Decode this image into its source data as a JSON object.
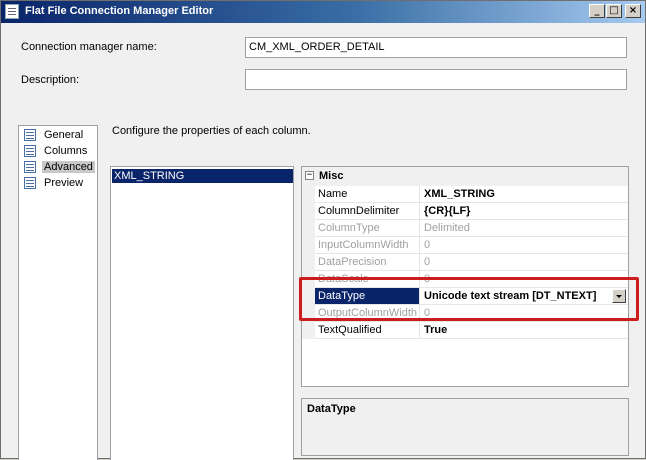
{
  "window": {
    "title": "Flat File Connection Manager Editor",
    "icon": "flat-file-icon"
  },
  "titlebar_buttons": {
    "minimize": "_",
    "maximize": "□",
    "close": "×"
  },
  "form": {
    "connection_name_label": "Connection manager name:",
    "connection_name_value": "CM_XML_ORDER_DETAIL",
    "description_label": "Description:",
    "description_value": ""
  },
  "nav": {
    "items": [
      {
        "label": "General",
        "icon": "general-icon"
      },
      {
        "label": "Columns",
        "icon": "columns-icon"
      },
      {
        "label": "Advanced",
        "icon": "advanced-icon",
        "selected": true
      },
      {
        "label": "Preview",
        "icon": "preview-icon"
      }
    ]
  },
  "main": {
    "instruction": "Configure the properties of each column.",
    "columns": [
      "XML_STRING"
    ]
  },
  "property_grid": {
    "category": "Misc",
    "properties": [
      {
        "name": "Name",
        "value": "XML_STRING",
        "bold": true,
        "disabled": false
      },
      {
        "name": "ColumnDelimiter",
        "value": "{CR}{LF}",
        "bold": true,
        "disabled": false
      },
      {
        "name": "ColumnType",
        "value": "Delimited",
        "bold": false,
        "disabled": true
      },
      {
        "name": "InputColumnWidth",
        "value": "0",
        "bold": false,
        "disabled": true
      },
      {
        "name": "DataPrecision",
        "value": "0",
        "bold": false,
        "disabled": true
      },
      {
        "name": "DataScale",
        "value": "0",
        "bold": false,
        "disabled": true
      },
      {
        "name": "DataType",
        "value": "Unicode text stream [DT_NTEXT]",
        "bold": true,
        "disabled": false,
        "selected": true
      },
      {
        "name": "OutputColumnWidth",
        "value": "0",
        "bold": false,
        "disabled": true
      },
      {
        "name": "TextQualified",
        "value": "True",
        "bold": true,
        "disabled": false
      }
    ]
  },
  "description_panel": {
    "title": "DataType"
  },
  "colors": {
    "highlight": "#cc1d1d",
    "selection": "#0a246a",
    "titlebar": "#0a246a"
  }
}
